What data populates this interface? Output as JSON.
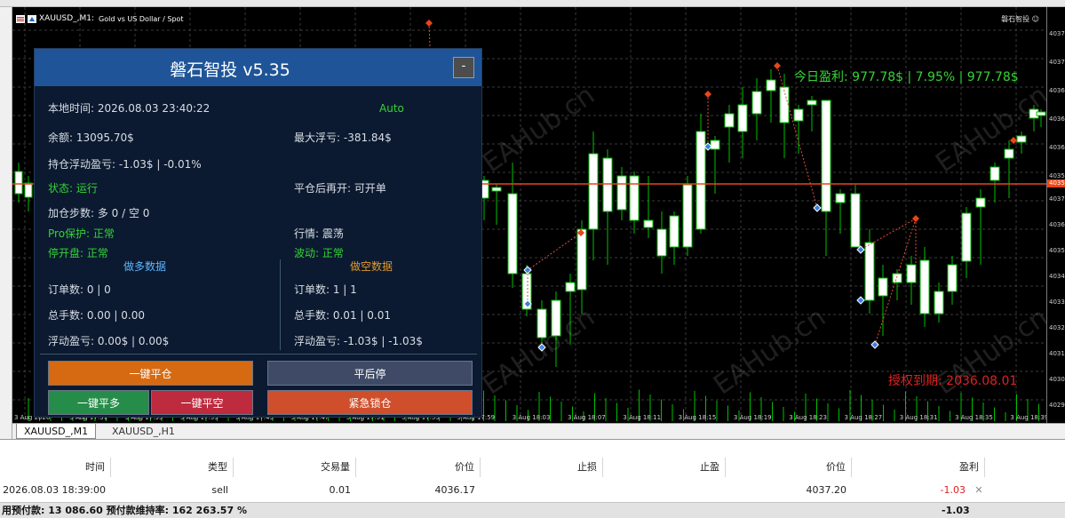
{
  "chart": {
    "symbol": "XAUUSD_,M1:",
    "description": "Gold vs US Dollar / Spot",
    "corner_label": "磐石智投 ☺",
    "bg": "#000000",
    "bull_color": "#00c000",
    "grid_color": "#3a3a3a",
    "price_line_color": "#e8451a",
    "price_axis": {
      "labels": [
        "4037",
        "4036",
        "4035",
        "4034",
        "4033",
        "4032",
        "4031",
        "4030",
        "4029"
      ],
      "current_price": "4035.",
      "top_labels": [
        "4037",
        "4037",
        "4036",
        "4036",
        "4036",
        "4035"
      ]
    },
    "time_labels": [
      "3 Aug 2026",
      "3 Aug 17:31",
      "3 Aug 17:35",
      "3 Aug 17:39",
      "3 Aug 17:43",
      "3 Aug 17:47",
      "3 Aug 17:51",
      "3 Aug 17:55",
      "3 Aug 17:59",
      "3 Aug 18:03",
      "3 Aug 18:07",
      "3 Aug 18:11",
      "3 Aug 18:15",
      "3 Aug 18:19",
      "3 Aug 18:23",
      "3 Aug 18:27",
      "3 Aug 18:31",
      "3 Aug 18:35",
      "3 Aug 18:39"
    ],
    "today_profit": "今日盈利: 977.78$ | 7.95% | 977.78$",
    "license": "授权到期: 2036.08.01",
    "watermark": "EAHub.cn"
  },
  "panel": {
    "title": "磐石智投 v5.35",
    "min_label": "-",
    "local_time": "本地时间: 2026.08.03 23:40:22",
    "mode": "Auto",
    "balance": "余额: 13095.70$",
    "max_float_loss": "最大浮亏: -381.84$",
    "holding_pl": "持仓浮动盈亏: -1.03$ | -0.01%",
    "status": "状态: 运行",
    "reopen": "平仓后再开: 可开单",
    "add_steps": "加仓步数: 多 0 / 空 0",
    "pro_protect": "Pro保护: 正常",
    "market": "行情: 震荡",
    "stop_open": "停开盘: 正常",
    "volatility": "波动: 正常",
    "long_title": "做多数据",
    "short_title": "做空数据",
    "long_orders": "订单数: 0 | 0",
    "short_orders": "订单数: 1 | 1",
    "long_lots": "总手数: 0.00 | 0.00",
    "short_lots": "总手数: 0.01 | 0.01",
    "long_float": "浮动盈亏: 0.00$ | 0.00$",
    "short_float": "浮动盈亏: -1.03$ | -1.03$",
    "btn_close_all": "一键平仓",
    "btn_close_stop": "平后停",
    "btn_close_long": "一键平多",
    "btn_close_short": "一键平空",
    "btn_lock": "紧急锁仓"
  },
  "tabs": [
    "XAUUSD_,M1",
    "XAUUSD_,H1"
  ],
  "terminal": {
    "headers": [
      "时间",
      "类型",
      "交易量",
      "价位",
      "止损",
      "止盈",
      "价位",
      "盈利"
    ],
    "row": [
      "2026.08.03 18:39:00",
      "sell",
      "0.01",
      "4036.17",
      "",
      "",
      "4037.20",
      "-1.03"
    ],
    "close_icon": "✕",
    "balance_line": "用预付款: 13 086.60  预付款维持率: 162 263.57 %",
    "total": "-1.03"
  }
}
